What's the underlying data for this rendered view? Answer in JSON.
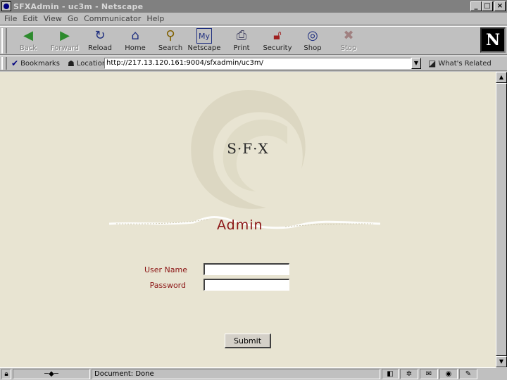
{
  "window": {
    "title": "SFXAdmin - uc3m - Netscape",
    "buttons": {
      "minimize": "_",
      "maximize": "□",
      "close": "×"
    }
  },
  "menu": [
    "File",
    "Edit",
    "View",
    "Go",
    "Communicator",
    "Help"
  ],
  "toolbar": {
    "back": "Back",
    "forward": "Forward",
    "reload": "Reload",
    "home": "Home",
    "search": "Search",
    "netscape": "Netscape",
    "print": "Print",
    "security": "Security",
    "shop": "Shop",
    "stop": "Stop",
    "logo": "N"
  },
  "locationbar": {
    "bookmarks": "Bookmarks",
    "location": "Location:",
    "url": "http://217.13.120.161:9004/sfxadmin/uc3m/",
    "related": "What's Related"
  },
  "page": {
    "logo_text": "S·F·X",
    "title": "Admin",
    "username_label": "User Name",
    "password_label": "Password",
    "username_value": "",
    "password_value": "",
    "submit_label": "Submit",
    "colors": {
      "accent": "#8b1414",
      "background": "#e8e4d2"
    }
  },
  "status": {
    "text": "Document: Done"
  }
}
